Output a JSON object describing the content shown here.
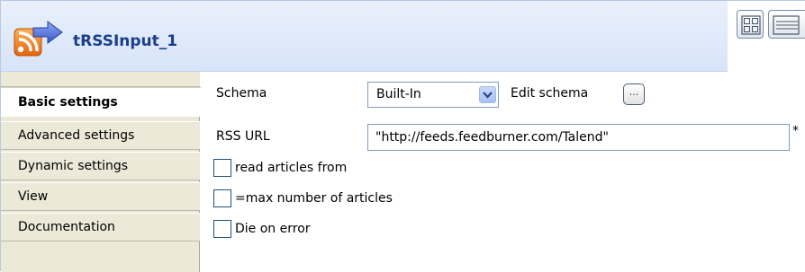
{
  "component": {
    "title": "tRSSInput_1",
    "icon": "rss-input-icon"
  },
  "view_buttons": [
    {
      "icon": "grid-layout-icon"
    },
    {
      "icon": "list-layout-icon"
    }
  ],
  "tabs": [
    {
      "label": "Basic settings",
      "active": true
    },
    {
      "label": "Advanced settings",
      "active": false
    },
    {
      "label": "Dynamic settings",
      "active": false
    },
    {
      "label": "View",
      "active": false
    },
    {
      "label": "Documentation",
      "active": false
    }
  ],
  "basic": {
    "schema_label": "Schema",
    "schema_value": "Built-In",
    "edit_schema_label": "Edit schema",
    "edit_schema_button": "...",
    "rss_url_label": "RSS URL",
    "rss_url_value": "\"http://feeds.feedburner.com/Talend\"",
    "required_mark": "*",
    "read_articles_label": "read articles from",
    "read_articles_checked": false,
    "max_articles_label": "=max number of articles",
    "max_articles_checked": false,
    "die_on_error_label": "Die on error",
    "die_on_error_checked": false
  },
  "colors": {
    "title": "#1a3e8c",
    "header_bg": "#d7e4f8",
    "tab_bg": "#ece9d8",
    "rss_orange": "#f07d1a"
  }
}
